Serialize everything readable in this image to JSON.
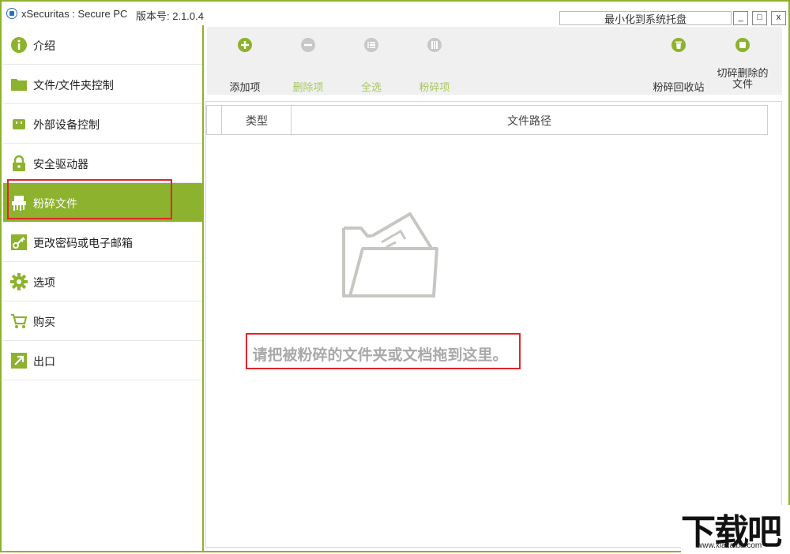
{
  "window": {
    "title": "xSecuritas : Secure PC",
    "version": "版本号: 2.1.0.4",
    "tray_button": "最小化到系统托盘",
    "minimize": "_",
    "maximize": "□",
    "close": "x"
  },
  "sidebar": {
    "items": [
      {
        "label": "介绍",
        "icon": "info-icon"
      },
      {
        "label": "文件/文件夹控制",
        "icon": "folder-icon"
      },
      {
        "label": "外部设备控制",
        "icon": "usb-icon"
      },
      {
        "label": "安全驱动器",
        "icon": "lock-icon"
      },
      {
        "label": "粉碎文件",
        "icon": "shredder-icon",
        "active": true
      },
      {
        "label": "更改密码或电子邮箱",
        "icon": "key-icon"
      },
      {
        "label": "选项",
        "icon": "gear-icon"
      },
      {
        "label": "购买",
        "icon": "cart-icon"
      },
      {
        "label": "出口",
        "icon": "exit-icon"
      }
    ]
  },
  "toolbar": {
    "add": "添加项",
    "remove": "删除项",
    "select_all": "全选",
    "shred": "粉碎项",
    "shred_recycle_bin": "粉碎回收站",
    "shred_deleted_line1": "切碎删除的",
    "shred_deleted_line2": "文件"
  },
  "list": {
    "columns": [
      "类型",
      "文件路径"
    ],
    "empty_message": "请把被粉碎的文件夹或文档拖到这里。"
  },
  "watermark": {
    "big": "下载吧",
    "small": "www.xiazaiba.com"
  },
  "colors": {
    "accent": "#8db22d",
    "highlight": "#e0262a",
    "disabled_text": "#a8c860"
  }
}
